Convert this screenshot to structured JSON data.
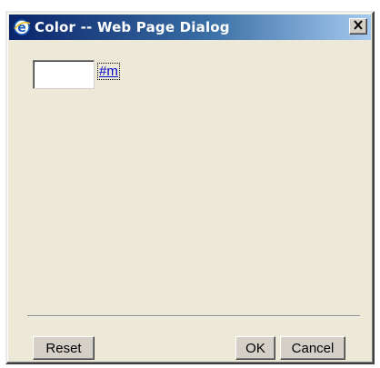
{
  "window": {
    "title": "Color -- Web Page Dialog",
    "close_label": "X"
  },
  "color_field": {
    "value": "",
    "link_label": "#m"
  },
  "buttons": {
    "reset": "Reset",
    "ok": "OK",
    "cancel": "Cancel"
  },
  "icons": {
    "title_icon": "ie-icon",
    "close_icon": "close-icon"
  },
  "colors": {
    "title_start": "#0a246a",
    "title_end": "#a6caf0",
    "face": "#ece9d8",
    "link": "#0000cc"
  }
}
